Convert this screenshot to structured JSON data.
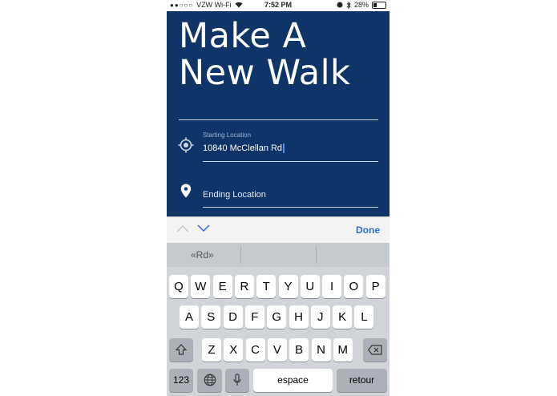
{
  "status_bar": {
    "carrier": "VZW Wi-Fi",
    "time": "7:52 PM",
    "battery": "28%",
    "battery_level": 0.28
  },
  "screen": {
    "title_line1": "Make A",
    "title_line2": "New Walk",
    "starting": {
      "label": "Starting Location",
      "value": "10840 McClellan Rd"
    },
    "ending": {
      "label": "Ending Location"
    }
  },
  "accessory": {
    "done_label": "Done"
  },
  "suggestion": "«Rd»",
  "keyboard": {
    "row1": [
      "Q",
      "W",
      "E",
      "R",
      "T",
      "Y",
      "U",
      "I",
      "O",
      "P"
    ],
    "row2": [
      "A",
      "S",
      "D",
      "F",
      "G",
      "H",
      "J",
      "K",
      "L"
    ],
    "row3": [
      "Z",
      "X",
      "C",
      "V",
      "B",
      "N",
      "M"
    ],
    "numbers_label": "123",
    "space_label": "espace",
    "return_label": "retour"
  },
  "colors": {
    "background": "#0f3467",
    "accent": "#2b6cd5",
    "caret": "#4a90ff"
  }
}
